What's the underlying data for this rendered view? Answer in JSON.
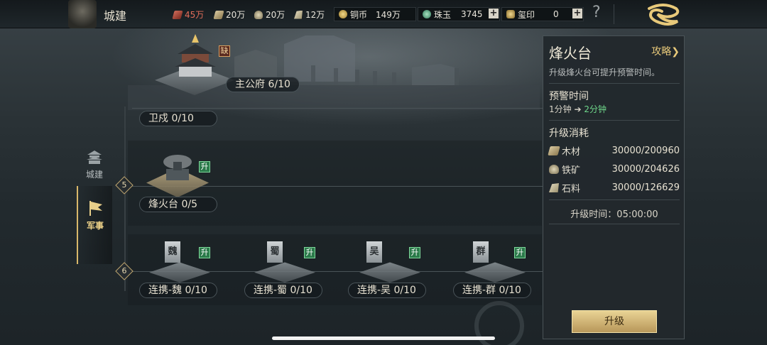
{
  "header": {
    "title": "城建",
    "resources": [
      {
        "name": "grain",
        "icon": "grain-icon",
        "value": "45万",
        "color": "#e36d5a"
      },
      {
        "name": "wood",
        "icon": "wood-icon",
        "value": "20万",
        "color": "#e8e2d2"
      },
      {
        "name": "iron",
        "icon": "iron-ore-icon",
        "value": "20万",
        "color": "#e8e2d2"
      },
      {
        "name": "stone",
        "icon": "stone-icon",
        "value": "12万",
        "color": "#e8e2d2"
      }
    ],
    "currencies": [
      {
        "label": "铜币",
        "value": "149万",
        "icon": "copper-coin-icon"
      },
      {
        "label": "珠玉",
        "value": "3745",
        "icon": "jade-icon"
      },
      {
        "label": "玺印",
        "value": "0",
        "icon": "seal-icon"
      }
    ],
    "plus_symbol": "+",
    "help_symbol": "?"
  },
  "nav": {
    "items": [
      {
        "label": "城建",
        "icon": "city-building-icon",
        "active": false
      },
      {
        "label": "军事",
        "icon": "military-flag-icon",
        "active": true
      }
    ]
  },
  "tree": {
    "rows": [
      {
        "level": "",
        "buildings": [
          {
            "name": "主公府 6/10",
            "tag": "缺"
          },
          {
            "name": "卫戍 0/10",
            "tag": ""
          }
        ]
      },
      {
        "level": "5",
        "buildings": [
          {
            "name": "烽火台 0/5",
            "tag": "升"
          }
        ]
      },
      {
        "level": "6",
        "buildings": [
          {
            "name": "连携-魏 0/10",
            "tag": "升",
            "banner": "魏"
          },
          {
            "name": "连携-蜀 0/10",
            "tag": "升",
            "banner": "蜀"
          },
          {
            "name": "连携-吴 0/10",
            "tag": "升",
            "banner": "吴"
          },
          {
            "name": "连携-群 0/10",
            "tag": "升",
            "banner": "群"
          }
        ]
      }
    ]
  },
  "panel": {
    "title": "烽火台",
    "guide_label": "攻略",
    "guide_arrow": "❯",
    "description": "升级烽火台可提升预警时间。",
    "warning_title": "预警时间",
    "warning_from": "1分钟",
    "warning_arrow": "➔",
    "warning_to": "2分钟",
    "cost_title": "升级消耗",
    "costs": [
      {
        "name": "木材",
        "value": "30000/200960",
        "icon": "wood-icon"
      },
      {
        "name": "铁矿",
        "value": "30000/204626",
        "icon": "iron-ore-icon"
      },
      {
        "name": "石料",
        "value": "30000/126629",
        "icon": "stone-icon"
      }
    ],
    "time_text": "升级时间：05:00:00",
    "upgrade_button": "升级"
  }
}
